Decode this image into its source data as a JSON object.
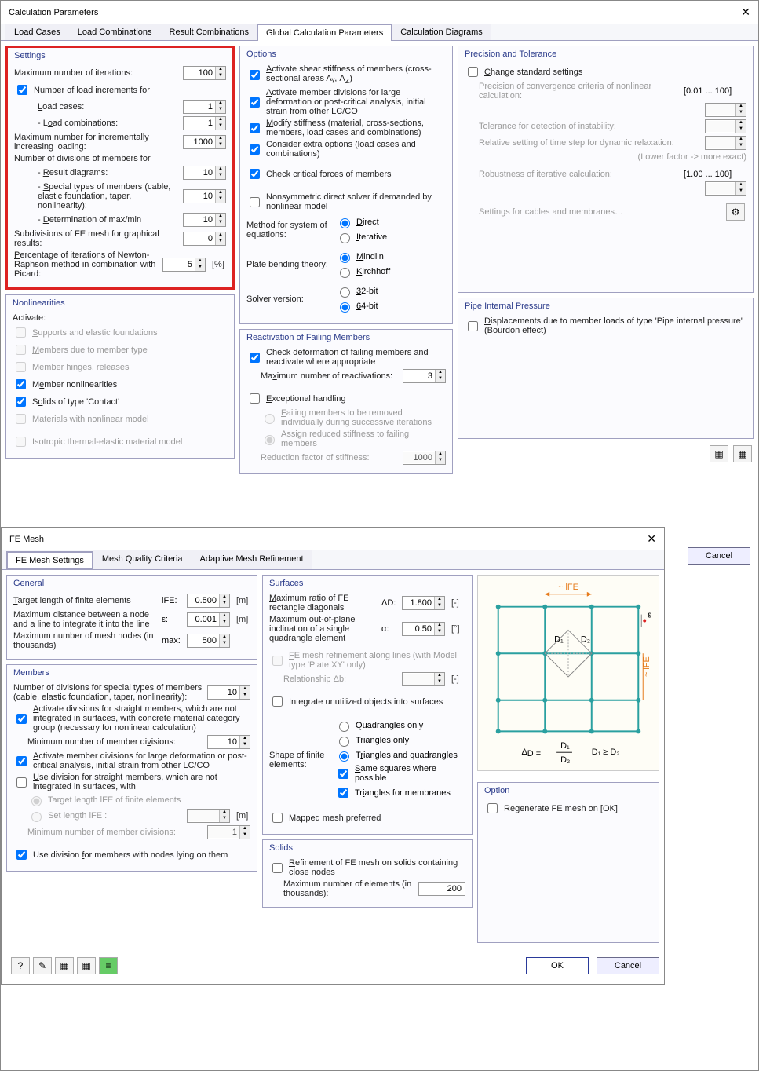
{
  "main": {
    "title": "Calculation Parameters",
    "tabs": [
      "Load Cases",
      "Load Combinations",
      "Result Combinations",
      "Global Calculation Parameters",
      "Calculation Diagrams"
    ],
    "active_tab": 3,
    "settings": {
      "title": "Settings",
      "max_iter_label": "Maximum number of iterations:",
      "max_iter": "100",
      "num_load_inc_label": "Number of load increments for",
      "load_cases_label": "- Load cases:",
      "load_cases": "1",
      "load_comb_label": "- Load combinations:",
      "load_comb": "1",
      "max_incr_label": "Maximum number for incrementally increasing loading:",
      "max_incr": "1000",
      "num_div_label": "Number of divisions of members for",
      "result_diag_label": "- Result diagrams:",
      "result_diag": "10",
      "special_types_label": "- Special types of members (cable, elastic foundation, taper, nonlinearity):",
      "special_types": "10",
      "det_maxmin_label": "- Determination of max/min",
      "det_maxmin": "10",
      "subdiv_label": "Subdivisions of FE mesh for graphical results:",
      "subdiv": "0",
      "perc_label": "Percentage of iterations of Newton-Raphson method in combination with Picard:",
      "perc": "5",
      "perc_unit": "[%]"
    },
    "options": {
      "title": "Options",
      "shear": "Activate shear stiffness of members (cross-sectional areas Aᵧ, A_z)",
      "divisions": "Activate member divisions for large deformation or post-critical analysis, initial strain from other LC/CO",
      "modify": "Modify stiffness (material, cross-sections, members, load cases and combinations)",
      "extra": "Consider extra options (load cases and combinations)",
      "check_crit": "Check critical forces of members",
      "nonsym": "Nonsymmetric direct solver if demanded by nonlinear model",
      "method_label": "Method for system of equations:",
      "direct": "Direct",
      "iterative": "Iterative",
      "plate_label": "Plate bending theory:",
      "mindlin": "Mindlin",
      "kirchhoff": "Kirchhoff",
      "solver_label": "Solver version:",
      "s32": "32-bit",
      "s64": "64-bit"
    },
    "precision": {
      "title": "Precision and Tolerance",
      "change": "Change standard settings",
      "prec_label": "Precision of convergence criteria of nonlinear calculation:",
      "range1": "[0.01 ... 100]",
      "tol_label": "Tolerance for detection of instability:",
      "rel_label": "Relative setting of time step for dynamic relaxation:",
      "note": "(Lower factor -> more exact)",
      "rob_label": "Robustness of iterative calculation:",
      "range2": "[1.00 ... 100]",
      "cables": "Settings for cables and membranes…"
    },
    "nonlin": {
      "title": "Nonlinearities",
      "activate": "Activate:",
      "supports": "Supports and elastic foundations",
      "members_type": "Members due to member type",
      "hinges": "Member hinges, releases",
      "member_nonlin": "Member nonlinearities",
      "solids": "Solids of type 'Contact'",
      "materials": "Materials with nonlinear model",
      "iso": "Isotropic thermal-elastic material model"
    },
    "react": {
      "title": "Reactivation of Failing Members",
      "check": "Check deformation of failing members and reactivate where appropriate",
      "max_label": "Maximum number of reactivations:",
      "max": "3",
      "exc": "Exceptional handling",
      "rem": "Failing members to be removed individually during successive iterations",
      "assign": "Assign reduced stiffness to failing members",
      "red_label": "Reduction factor of stiffness:",
      "red": "1000"
    },
    "pipe": {
      "title": "Pipe Internal Pressure",
      "disp": "Displacements due to member loads of type 'Pipe internal pressure' (Bourdon effect)"
    },
    "cancel": "Cancel"
  },
  "fe": {
    "title": "FE Mesh",
    "tabs": [
      "FE Mesh Settings",
      "Mesh Quality Criteria",
      "Adaptive Mesh Refinement"
    ],
    "general": {
      "title": "General",
      "target_label": "Target length of finite elements",
      "lfe": "lFE:",
      "target": "0.500",
      "target_unit": "[m]",
      "maxdist_label": "Maximum distance between a node and a line to integrate it into the line",
      "eps": "ε:",
      "maxdist": "0.001",
      "maxdist_unit": "[m]",
      "maxnodes_label": "Maximum number of mesh nodes (in thousands)",
      "max": "max:",
      "maxnodes": "500"
    },
    "members": {
      "title": "Members",
      "numdiv_label": "Number of divisions for special types of members (cable, elastic foundation, taper, nonlinearity):",
      "numdiv": "10",
      "act_div": "Activate divisions for straight members, which are not integrated in surfaces, with concrete material category group (necessary for nonlinear calculation)",
      "min_div_label": "Minimum number of member divisions:",
      "min_div": "10",
      "act_mem": "Activate member divisions for large deformation or post-critical analysis, initial strain from other LC/CO",
      "use_div": "Use division for straight members, which are not integrated in surfaces, with",
      "target_len": "Target length lFE of finite elements",
      "set_len": "Set length lFE :",
      "set_len_unit": "[m]",
      "min_num_label": "Minimum number of member divisions:",
      "min_num": "1",
      "use_nodes": "Use division for members with nodes lying on them"
    },
    "surfaces": {
      "title": "Surfaces",
      "maxratio_label": "Maximum ratio of FE rectangle diagonals",
      "dd": "ΔD:",
      "maxratio": "1.800",
      "maxratio_unit": "[-]",
      "maxout_label": "Maximum out-of-plane inclination of a single quadrangle element",
      "alpha": "α:",
      "maxout": "0.50",
      "maxout_unit": "[°]",
      "ref_lines": "FE mesh refinement along lines (with Model type 'Plate XY' only)",
      "rel_label": "Relationship Δb:",
      "rel_unit": "[-]",
      "integrate": "Integrate unutilized objects into surfaces",
      "shape_label": "Shape of finite elements:",
      "quad": "Quadrangles only",
      "tri": "Triangles only",
      "triquad": "Triangles and quadrangles",
      "same": "Same squares where possible",
      "trimem": "Triangles for membranes",
      "mapped": "Mapped mesh preferred"
    },
    "solids": {
      "title": "Solids",
      "ref": "Refinement of FE mesh on solids containing close nodes",
      "max_label": "Maximum number of elements (in thousands):",
      "max": "200"
    },
    "option": {
      "title": "Option",
      "regen": "Regenerate FE mesh on [OK]"
    },
    "diagram": {
      "lfe": "~ lFE",
      "eps": "ε",
      "d1": "D₁",
      "d2": "D₂",
      "lfe2": "~ lFE",
      "formula": "ΔD  =",
      "frac_top": "D₁",
      "frac_bot": "D₂",
      "ineq": "D₁ ≥ D₂"
    },
    "ok": "OK",
    "cancel": "Cancel"
  }
}
